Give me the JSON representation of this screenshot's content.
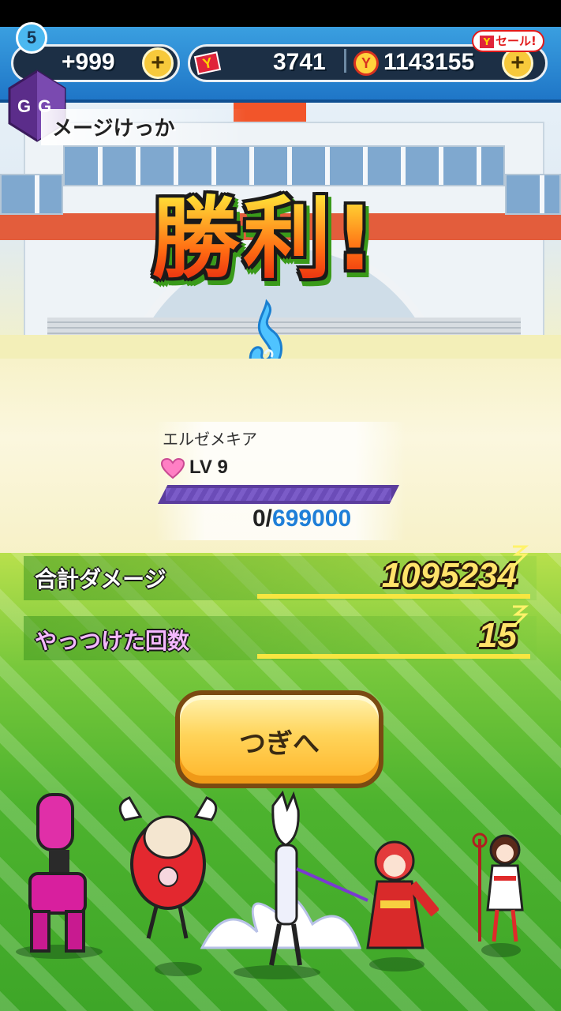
{
  "hud": {
    "badge_level": "5",
    "stamina_value": "+999",
    "ticket_value": "3741",
    "money_value": "1143155",
    "plus_label": "+",
    "ticket_icon_label": "Y",
    "coin_icon_label": "Y",
    "sale_label": "セール!",
    "sale_icon_label": "Y"
  },
  "header": {
    "title": "メージけっか"
  },
  "victory": {
    "text": "勝利!"
  },
  "yokai": {
    "name": "エルゼメキア",
    "level_text": "LV  9",
    "exp_current": "0/",
    "exp_max": "699000",
    "exp_progress": 0
  },
  "stats": {
    "total_damage_label": "合計ダメージ",
    "total_damage_value": "1095234",
    "defeat_count_label": "やっつけた回数",
    "defeat_count_value": "15"
  },
  "buttons": {
    "next_label": "つぎへ"
  },
  "colors": {
    "hud_blue": "#1f76c7",
    "exp_blue": "#1f7fd8",
    "button_gold": "#ffd45a",
    "stat_gold": "#ffe36a",
    "label_purple": "#f5b8ff"
  },
  "icons": [
    "gg-icon",
    "heart-icon",
    "spirit-flame-icon",
    "y-ticket-icon",
    "y-coin-icon",
    "sparkle-icon"
  ]
}
